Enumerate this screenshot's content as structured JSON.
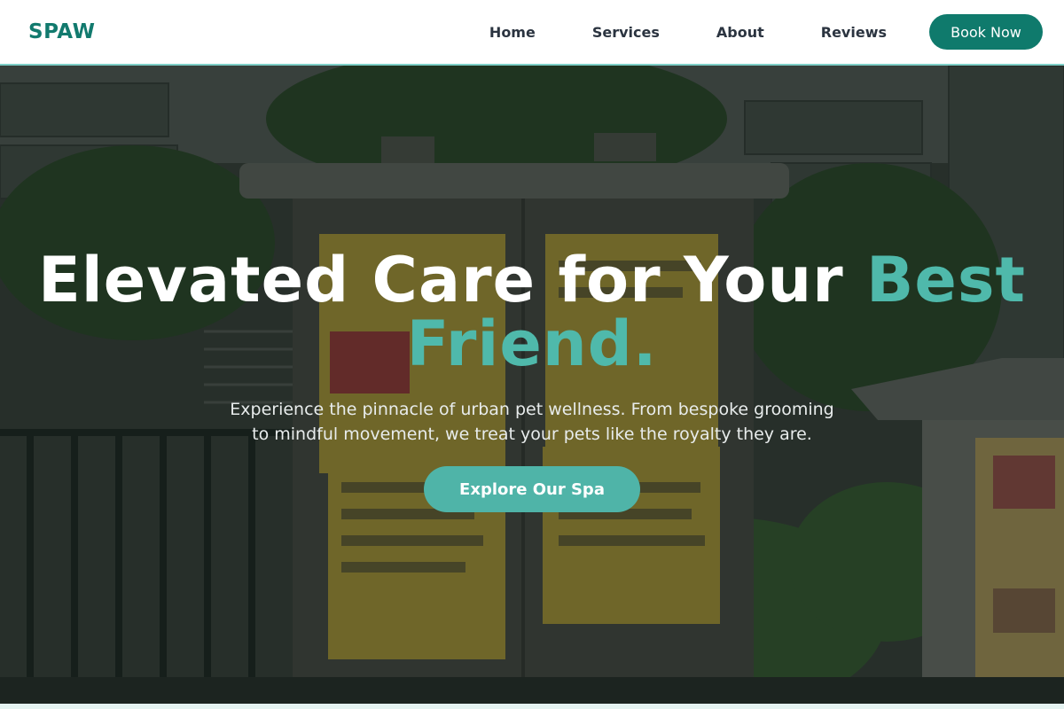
{
  "brand": {
    "logo": "SPAW"
  },
  "nav": {
    "links": [
      "Home",
      "Services",
      "About",
      "Reviews"
    ],
    "cta_label": "Book Now"
  },
  "hero": {
    "title_main": "Elevated Care for Your ",
    "title_accent": "Best Friend.",
    "subtitle": "Experience the pinnacle of urban pet wellness. From bespoke grooming to mindful movement, we treat your pets like the royalty they are.",
    "cta_label": "Explore Our Spa"
  },
  "colors": {
    "brand": "#127a6e",
    "accent": "#4fb9ab",
    "cta_background": "#0f7a6c",
    "nav_text": "#2b3440"
  }
}
